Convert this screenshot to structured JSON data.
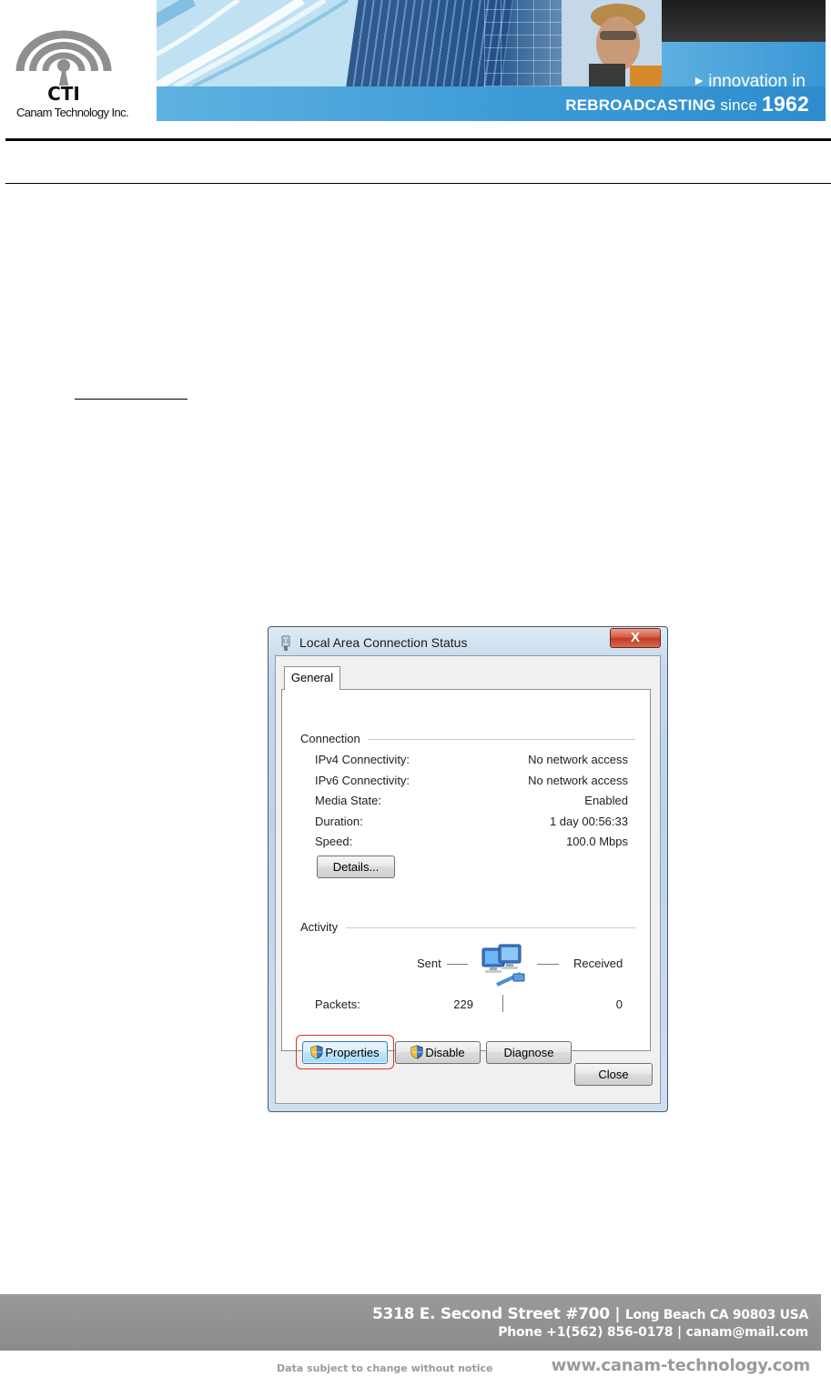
{
  "header": {
    "company_name": "Canam Technology Inc.",
    "logo_word": "CTI",
    "tagline_line1": "innovation in",
    "tagline_rebroadcasting": "REBROADCASTING",
    "tagline_since": "since",
    "tagline_year": "1962",
    "accent_color": "#3c9ad6"
  },
  "dialog": {
    "title": "Local Area Connection Status",
    "close_glyph": "X",
    "tabs": [
      {
        "label": "General",
        "selected": true
      }
    ],
    "connection": {
      "group_label": "Connection",
      "rows": [
        {
          "label": "IPv4 Connectivity:",
          "value": "No network access"
        },
        {
          "label": "IPv6 Connectivity:",
          "value": "No network access"
        },
        {
          "label": "Media State:",
          "value": "Enabled"
        },
        {
          "label": "Duration:",
          "value": "1 day 00:56:33"
        },
        {
          "label": "Speed:",
          "value": "100.0 Mbps"
        }
      ],
      "details_button": "Details..."
    },
    "activity": {
      "group_label": "Activity",
      "sent_label": "Sent",
      "received_label": "Received",
      "packets_label": "Packets:",
      "packets_sent": "229",
      "packets_received": "0"
    },
    "buttons": {
      "properties": "Properties",
      "disable": "Disable",
      "diagnose": "Diagnose",
      "close": "Close"
    },
    "highlight_color": "#e03030"
  },
  "footer": {
    "address_street": "5318 E. Second Street  #700 |",
    "address_city": "Long Beach CA 90803 USA",
    "contact": "Phone +1(562) 856-0178 | canam@mail.com",
    "notice": "Data subject to change without notice",
    "website": "www.canam-technology.com"
  }
}
